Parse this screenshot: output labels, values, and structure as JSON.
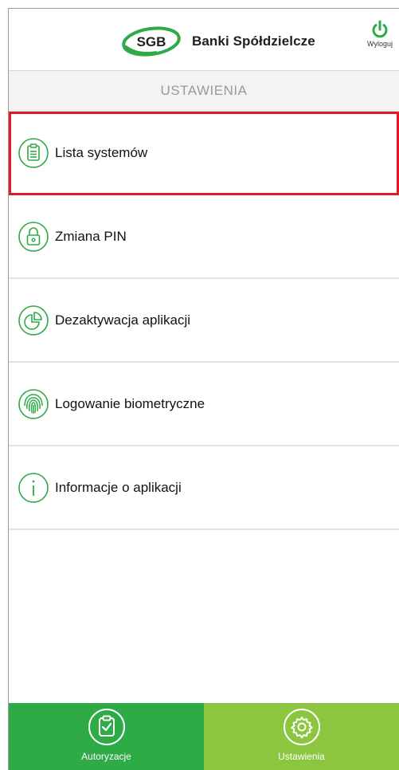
{
  "header": {
    "logo_badge": "SGB",
    "logo_text": "Banki Spółdzielcze",
    "logout_label": "Wyloguj",
    "logout_icon": "power-icon"
  },
  "subheader": {
    "title": "USTAWIENIA"
  },
  "menu": {
    "items": [
      {
        "label": "Lista systemów",
        "icon": "clipboard-icon",
        "highlighted": true
      },
      {
        "label": "Zmiana PIN",
        "icon": "lock-icon"
      },
      {
        "label": "Dezaktywacja aplikacji",
        "icon": "pie-chart-icon"
      },
      {
        "label": "Logowanie biometryczne",
        "icon": "fingerprint-icon"
      },
      {
        "label": "Informacje o aplikacji",
        "icon": "info-icon"
      }
    ]
  },
  "bottom_nav": {
    "tabs": [
      {
        "label": "Autoryzacje",
        "icon": "clipboard-check-icon",
        "color": "#2eaa47"
      },
      {
        "label": "Ustawienia",
        "icon": "gear-icon",
        "color": "#8cc63f",
        "active": true
      }
    ]
  },
  "colors": {
    "brand_green": "#2eaa47",
    "light_green": "#8cc63f",
    "highlight_red": "#e01b24"
  }
}
